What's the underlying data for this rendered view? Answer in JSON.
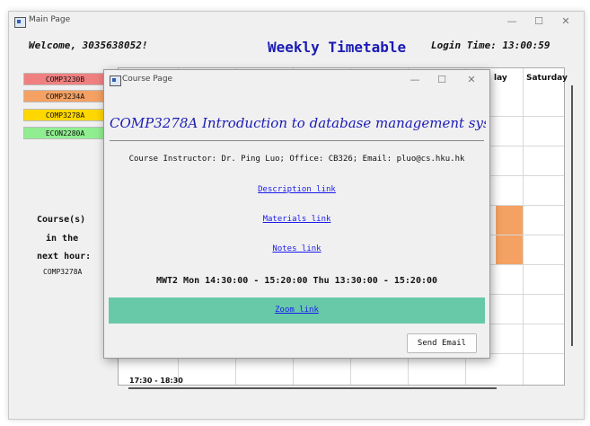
{
  "main_window": {
    "title": "Main Page",
    "controls": {
      "minimize": "—",
      "maximize": "☐",
      "close": "✕"
    }
  },
  "header": {
    "welcome": "Welcome, 3035638052!",
    "title": "Weekly Timetable",
    "login_time": "Login Time: 13:00:59"
  },
  "courses": [
    {
      "code": "COMP3230B",
      "color": "#f08080"
    },
    {
      "code": "COMP3234A",
      "color": "#f4a163"
    },
    {
      "code": "COMP3278A",
      "color": "#ffd700"
    },
    {
      "code": "ECON2280A",
      "color": "#90ee90"
    }
  ],
  "next_hour": {
    "line1": "Course(s)",
    "line2": "in the",
    "line3": "next hour:",
    "course": "COMP3278A"
  },
  "timetable": {
    "headers": [
      "lay",
      "Saturday"
    ],
    "last_time": "17:30 - 18:30"
  },
  "dialog": {
    "title": "Course Page",
    "controls": {
      "minimize": "—",
      "maximize": "☐",
      "close": "✕"
    },
    "course_title": "COMP3278A Introduction to database management sys",
    "instructor": "Course Instructor: Dr. Ping Luo; Office: CB326; Email: pluo@cs.hku.hk",
    "description_link": "Description link",
    "materials_link": "Materials link",
    "notes_link": "Notes link",
    "schedule": "MWT2 Mon 14:30:00 - 15:20:00 Thu 13:30:00 - 15:20:00",
    "zoom_link": "Zoom link",
    "send_email": "Send Email"
  }
}
